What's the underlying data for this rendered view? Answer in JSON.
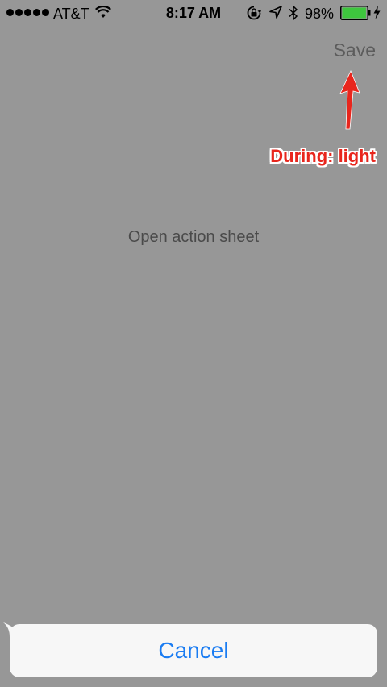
{
  "status_bar": {
    "carrier": "AT&T",
    "time": "8:17 AM",
    "battery_percent": "98%",
    "signal_bars": 5,
    "battery_level": 0.98,
    "icons": [
      "signal-dots-icon",
      "wifi-icon",
      "lock-rotation-icon",
      "location-icon",
      "bluetooth-icon",
      "battery-icon",
      "charging-icon"
    ]
  },
  "nav": {
    "save_label": "Save"
  },
  "annotation": {
    "label": "During: light",
    "color": "#e8261d"
  },
  "content": {
    "action_label": "Open action sheet"
  },
  "action_sheet": {
    "cancel_label": "Cancel",
    "accent": "#1a7cf2"
  },
  "colors": {
    "dim_background": "#979797",
    "sheet_background": "#f7f7f7",
    "battery_fill": "#3ec63e"
  }
}
